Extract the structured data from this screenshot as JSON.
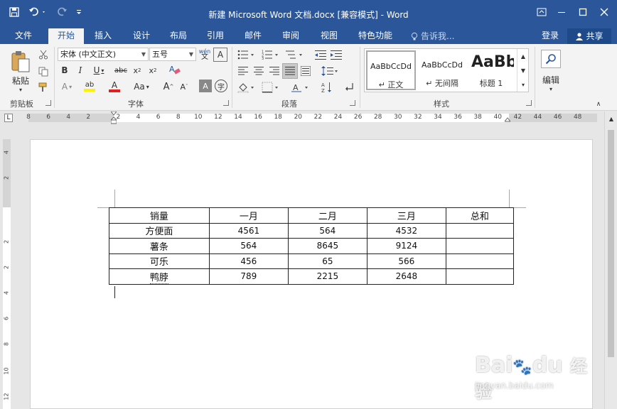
{
  "titlebar": {
    "title": "新建 Microsoft Word 文档.docx [兼容模式] - Word",
    "bg_color": "#2b579a"
  },
  "tabs": [
    {
      "label": "文件",
      "active": false
    },
    {
      "label": "开始",
      "active": true
    },
    {
      "label": "插入",
      "active": false
    },
    {
      "label": "设计",
      "active": false
    },
    {
      "label": "布局",
      "active": false
    },
    {
      "label": "引用",
      "active": false
    },
    {
      "label": "邮件",
      "active": false
    },
    {
      "label": "审阅",
      "active": false
    },
    {
      "label": "视图",
      "active": false
    },
    {
      "label": "特色功能",
      "active": false
    }
  ],
  "tell_me": "告诉我...",
  "login": "登录",
  "share": "共享",
  "ribbon": {
    "clipboard": {
      "label": "剪贴板",
      "paste": "粘贴"
    },
    "font": {
      "label": "字体",
      "font_name": "宋体 (中文正文)",
      "font_size": "五号"
    },
    "paragraph": {
      "label": "段落"
    },
    "styles": {
      "label": "样式",
      "items": [
        {
          "sample": "AaBbCcDd",
          "name": "↵ 正文"
        },
        {
          "sample": "AaBbCcDd",
          "name": "↵ 无间隔"
        },
        {
          "sample": "AaBb",
          "name": "标题 1"
        }
      ]
    },
    "editing": {
      "label": "编辑"
    }
  },
  "ruler": {
    "h_ticks": [
      "8",
      "6",
      "4",
      "2",
      "2",
      "4",
      "6",
      "8",
      "10",
      "12",
      "14",
      "16",
      "18",
      "20",
      "22",
      "24",
      "26",
      "28",
      "30",
      "32",
      "34",
      "36",
      "38",
      "40",
      "42",
      "44",
      "46",
      "48"
    ],
    "v_ticks": [
      "4",
      "2",
      "2",
      "2",
      "4",
      "6",
      "8",
      "10",
      "12"
    ]
  },
  "table": {
    "headers": [
      "销量",
      "一月",
      "二月",
      "三月",
      "总和"
    ],
    "rows": [
      [
        "方便面",
        "4561",
        "564",
        "4532",
        ""
      ],
      [
        "薯条",
        "564",
        "8645",
        "9124",
        ""
      ],
      [
        "可乐",
        "456",
        "65",
        "566",
        ""
      ],
      [
        "鸭脖",
        "789",
        "2215",
        "2648",
        ""
      ]
    ]
  },
  "watermark": {
    "brand": "Bai",
    "brand2": "du",
    "cn": "经验",
    "url": "jingyan.baidu.com"
  }
}
